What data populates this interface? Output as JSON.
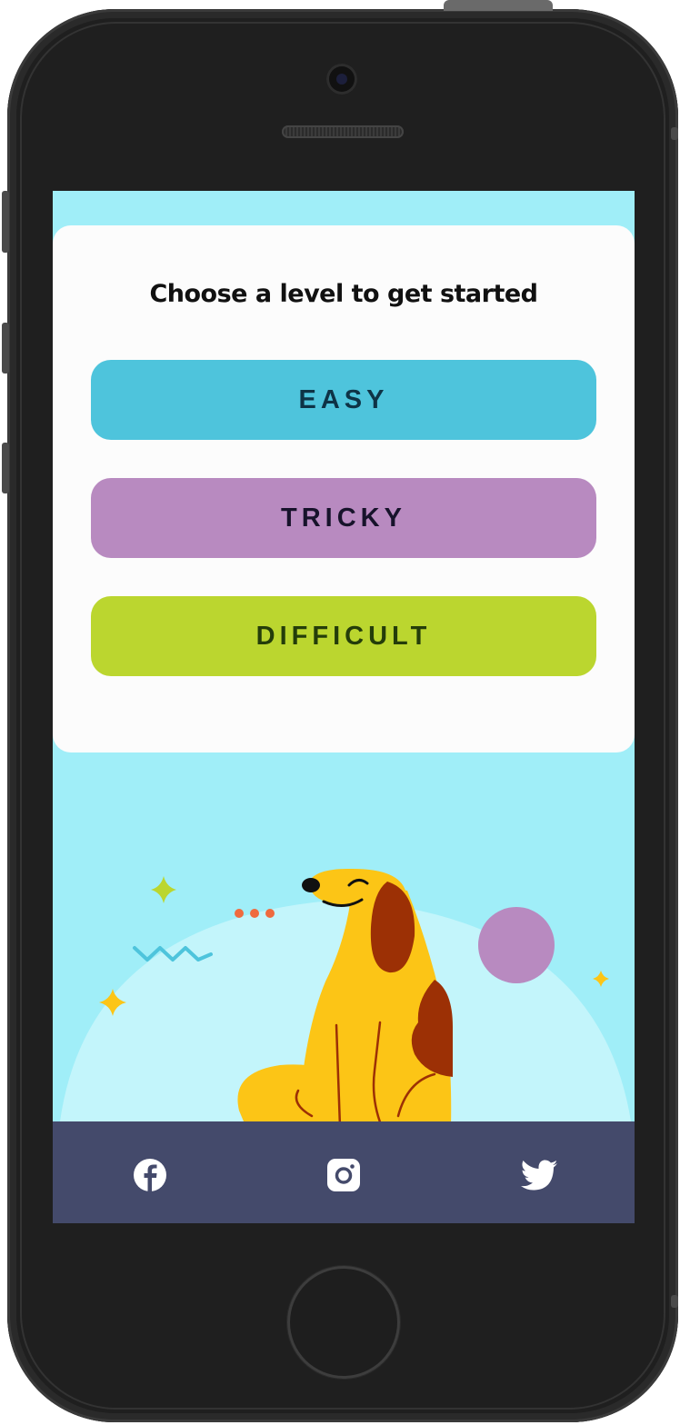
{
  "app": {
    "heading": "Choose a level to get started"
  },
  "levels": [
    {
      "label": "EASY",
      "bg": "#4ec4dc",
      "fg": "#0e3346"
    },
    {
      "label": "TRICKY",
      "bg": "#b88ac0",
      "fg": "#17132b"
    },
    {
      "label": "DIFFICULT",
      "bg": "#bbd62f",
      "fg": "#243d0a"
    }
  ],
  "footer": {
    "icons": [
      "facebook-icon",
      "instagram-icon",
      "twitter-icon"
    ]
  },
  "colors": {
    "screen_background": "#a0eef8",
    "card": "#fcfcfc",
    "footer": "#444a6b",
    "dog": "#fcc516",
    "dog_spots": "#9c3005",
    "hill": "#c3f5fb",
    "ball": "#b88ac0"
  }
}
